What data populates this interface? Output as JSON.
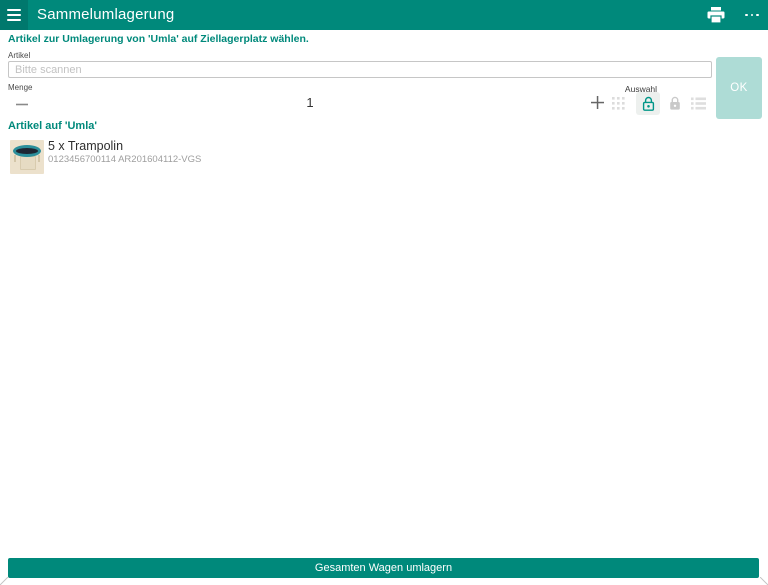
{
  "header": {
    "title": "Sammelumlagerung"
  },
  "instruction": {
    "text": "Artikel zur Umlagerung von 'Umla' auf Ziellagerplatz wählen."
  },
  "article": {
    "label": "Artikel",
    "placeholder": "Bitte scannen",
    "value": ""
  },
  "quantity": {
    "label": "Menge",
    "value": "1",
    "selection_label": "Auswahl"
  },
  "ok_button": {
    "label": "OK"
  },
  "cart": {
    "header": "Artikel auf 'Umla'",
    "items": [
      {
        "title": "5 x Trampolin",
        "subtitle": "0123456700114 AR201604112-VGS"
      }
    ]
  },
  "footer": {
    "button_label": "Gesamten Wagen umlagern"
  },
  "icons": {
    "menu": "hamburger-menu",
    "print": "printer",
    "overflow": "three-dot-menu",
    "minus": "decrease-quantity",
    "plus": "increase-quantity",
    "grid": "grid-select",
    "lock_outline": "lock-outline-active",
    "lock_filled": "lock-filled-inactive",
    "list": "list-view"
  },
  "colors": {
    "accent": "#00897b",
    "accent_dark": "#00786d",
    "ok_disabled_bg": "#aedcd6",
    "lock_active": "#009688",
    "icon_disabled": "#dcdcdc"
  }
}
